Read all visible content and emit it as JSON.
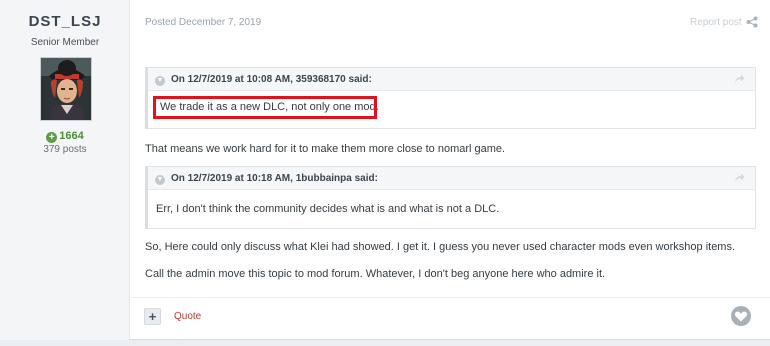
{
  "author": {
    "name": "DST_LSJ",
    "rank": "Senior Member",
    "reputation": "1664",
    "post_count": "379 posts"
  },
  "post": {
    "posted_date": "Posted December 7, 2019",
    "report_label": "Report post",
    "quotes": [
      {
        "citation": "On 12/7/2019 at 10:08 AM, 359368170 said:",
        "text": "We trade it as a new DLC, not only one mod."
      },
      {
        "citation": "On 12/7/2019 at 10:18 AM, 1bubbainpa said:",
        "text": "Err, I don't think the community decides what is and what is not a DLC."
      }
    ],
    "paragraphs": [
      "That means we work hard for it to make them more close to nomarl game.",
      "So, Here could only discuss what Klei had showed. I get it. I guess you never used character mods even workshop items.",
      "Call the  admin move this topic to mod forum. Whatever, I don't beg anyone here who admire it."
    ]
  },
  "actions": {
    "plus_label": "+",
    "quote_label": "Quote"
  },
  "colors": {
    "highlight": "#e0121c",
    "reputation": "#4f8a3b",
    "quote_link": "#c0392b"
  },
  "icons": {
    "rep": "plus-circle-icon",
    "share": "share-icon",
    "collapse": "chevron-down-icon",
    "goto": "arrow-icon",
    "like": "heart-icon"
  }
}
